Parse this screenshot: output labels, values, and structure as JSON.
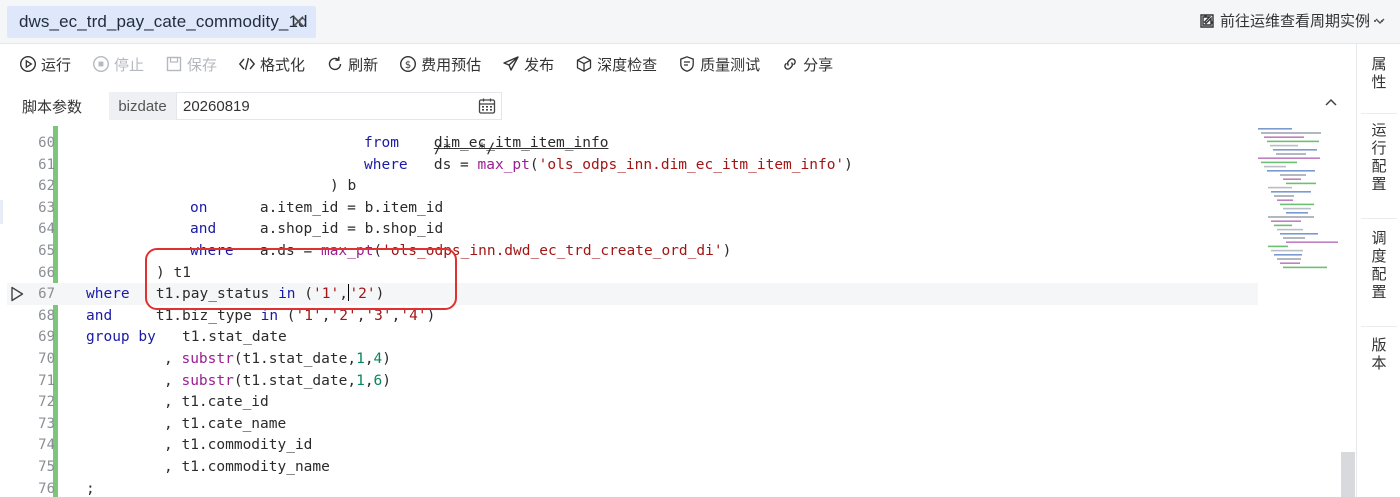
{
  "tab": {
    "title": "dws_ec_trd_pay_cate_commodity_1d",
    "close": "✕"
  },
  "menu": {
    "more": "···"
  },
  "toolbar": {
    "items": [
      {
        "label": "运行",
        "icon": "play-circle-icon",
        "disabled": false
      },
      {
        "label": "停止",
        "icon": "stop-circle-icon",
        "disabled": true
      },
      {
        "label": "保存",
        "icon": "save-icon",
        "disabled": true
      },
      {
        "label": "格式化",
        "icon": "code-icon",
        "disabled": false
      },
      {
        "label": "刷新",
        "icon": "refresh-icon",
        "disabled": false
      },
      {
        "label": "费用预估",
        "icon": "dollar-circle-icon",
        "disabled": false
      },
      {
        "label": "发布",
        "icon": "send-icon",
        "disabled": false
      },
      {
        "label": "深度检查",
        "icon": "cube-icon",
        "disabled": false
      },
      {
        "label": "质量测试",
        "icon": "shield-icon",
        "disabled": false
      },
      {
        "label": "分享",
        "icon": "link-icon",
        "disabled": false
      }
    ],
    "ops_link": "前往运维查看周期实例"
  },
  "params": {
    "label": "脚本参数",
    "key": "bizdate",
    "value": "20260819"
  },
  "side": [
    {
      "label": "属性"
    },
    {
      "label": "运行配置"
    },
    {
      "label": "调度配置"
    },
    {
      "label": "版本"
    }
  ],
  "code": {
    "partial_top": "/*   */",
    "current_line": 67,
    "lines": [
      {
        "n": "60",
        "indent": 278,
        "tokens": [
          {
            "t": "from",
            "c": "kw"
          },
          {
            "t": "    ",
            "c": "plain"
          },
          {
            "t": "dim_ec_itm_item_info",
            "c": "plain und"
          }
        ]
      },
      {
        "n": "61",
        "indent": 278,
        "tokens": [
          {
            "t": "where",
            "c": "kw"
          },
          {
            "t": "   ds = ",
            "c": "plain"
          },
          {
            "t": "max_pt",
            "c": "fn"
          },
          {
            "t": "(",
            "c": "plain"
          },
          {
            "t": "'ols_odps_inn.dim_ec_itm_item_info'",
            "c": "str"
          },
          {
            "t": ")",
            "c": "plain"
          }
        ]
      },
      {
        "n": "62",
        "indent": 244,
        "tokens": [
          {
            "t": ") b",
            "c": "plain"
          }
        ]
      },
      {
        "n": "63",
        "indent": 104,
        "tokens": [
          {
            "t": "on",
            "c": "kw"
          },
          {
            "t": "      a.item_id = b.item_id",
            "c": "plain"
          }
        ]
      },
      {
        "n": "64",
        "indent": 104,
        "tokens": [
          {
            "t": "and",
            "c": "kw"
          },
          {
            "t": "     a.shop_id = b.shop_id",
            "c": "plain"
          }
        ]
      },
      {
        "n": "65",
        "indent": 104,
        "tokens": [
          {
            "t": "where",
            "c": "kw"
          },
          {
            "t": "   a.ds = ",
            "c": "plain"
          },
          {
            "t": "max_pt",
            "c": "fn"
          },
          {
            "t": "(",
            "c": "plain"
          },
          {
            "t": "'ols_odps_inn.dwd_ec_trd_create_ord_di'",
            "c": "str"
          },
          {
            "t": ")",
            "c": "plain"
          }
        ]
      },
      {
        "n": "66",
        "indent": 70,
        "tokens": [
          {
            "t": ") t1",
            "c": "plain"
          }
        ]
      },
      {
        "n": "67",
        "indent": 0,
        "tokens": [
          {
            "t": "where",
            "c": "kw"
          },
          {
            "t": "   t1.pay_status ",
            "c": "plain"
          },
          {
            "t": "in",
            "c": "kw"
          },
          {
            "t": " (",
            "c": "plain"
          },
          {
            "t": "'1'",
            "c": "str"
          },
          {
            "t": ",",
            "c": "plain"
          },
          {
            "t": "CURSOR",
            "c": "cursor"
          },
          {
            "t": "'2'",
            "c": "str"
          },
          {
            "t": ")",
            "c": "plain"
          }
        ]
      },
      {
        "n": "68",
        "indent": 0,
        "tokens": [
          {
            "t": "and",
            "c": "kw"
          },
          {
            "t": "     t1.biz_type ",
            "c": "plain"
          },
          {
            "t": "in",
            "c": "kw"
          },
          {
            "t": " (",
            "c": "plain"
          },
          {
            "t": "'1'",
            "c": "str"
          },
          {
            "t": ",",
            "c": "plain"
          },
          {
            "t": "'2'",
            "c": "str"
          },
          {
            "t": ",",
            "c": "plain"
          },
          {
            "t": "'3'",
            "c": "str"
          },
          {
            "t": ",",
            "c": "plain"
          },
          {
            "t": "'4'",
            "c": "str"
          },
          {
            "t": ")",
            "c": "plain"
          }
        ]
      },
      {
        "n": "69",
        "indent": 0,
        "tokens": [
          {
            "t": "group by",
            "c": "kw"
          },
          {
            "t": "   t1.stat_date",
            "c": "plain"
          }
        ]
      },
      {
        "n": "70",
        "indent": 78,
        "tokens": [
          {
            "t": ", ",
            "c": "plain"
          },
          {
            "t": "substr",
            "c": "fn"
          },
          {
            "t": "(t1.stat_date,",
            "c": "plain"
          },
          {
            "t": "1",
            "c": "num"
          },
          {
            "t": ",",
            "c": "plain"
          },
          {
            "t": "4",
            "c": "num"
          },
          {
            "t": ")",
            "c": "plain"
          }
        ]
      },
      {
        "n": "71",
        "indent": 78,
        "tokens": [
          {
            "t": ", ",
            "c": "plain"
          },
          {
            "t": "substr",
            "c": "fn"
          },
          {
            "t": "(t1.stat_date,",
            "c": "plain"
          },
          {
            "t": "1",
            "c": "num"
          },
          {
            "t": ",",
            "c": "plain"
          },
          {
            "t": "6",
            "c": "num"
          },
          {
            "t": ")",
            "c": "plain"
          }
        ]
      },
      {
        "n": "72",
        "indent": 78,
        "tokens": [
          {
            "t": ", t1.cate_id",
            "c": "plain"
          }
        ]
      },
      {
        "n": "73",
        "indent": 78,
        "tokens": [
          {
            "t": ", t1.cate_name",
            "c": "plain"
          }
        ]
      },
      {
        "n": "74",
        "indent": 78,
        "tokens": [
          {
            "t": ", t1.commodity_id",
            "c": "plain"
          }
        ]
      },
      {
        "n": "75",
        "indent": 78,
        "tokens": [
          {
            "t": ", t1.commodity_name",
            "c": "plain"
          }
        ]
      },
      {
        "n": "76",
        "indent": 0,
        "tokens": [
          {
            "t": ";",
            "c": "plain"
          }
        ]
      }
    ]
  }
}
